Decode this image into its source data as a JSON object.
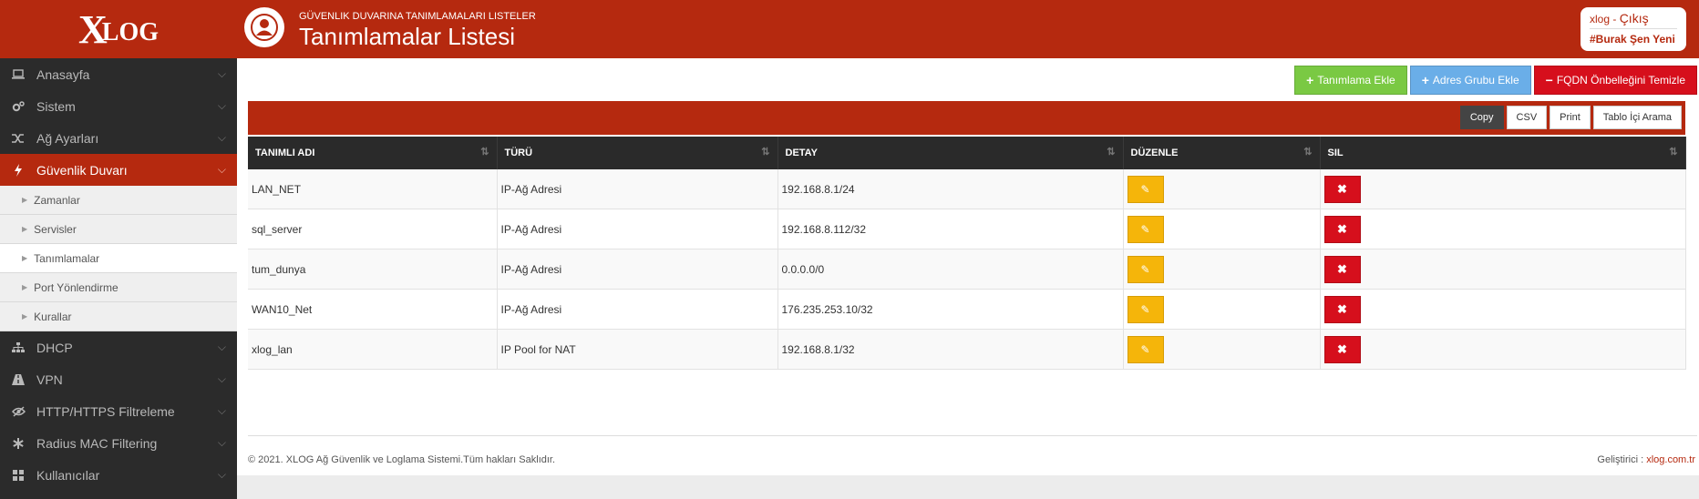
{
  "header": {
    "logo_big": "X",
    "logo_small": "LOG",
    "subtitle": "GÜVENLIK DUVARINA TANIMLAMALARI LISTELER",
    "title": "Tanımlamalar Listesi",
    "user_app": "xlog - ",
    "logout": "Çıkış",
    "user_name": "#Burak Şen Yeni"
  },
  "sidebar": {
    "items_top": [
      {
        "label": "Anasayfa",
        "icon": "laptop-icon"
      },
      {
        "label": "Sistem",
        "icon": "cogs-icon"
      },
      {
        "label": "Ağ Ayarları",
        "icon": "shuffle-icon"
      },
      {
        "label": "Güvenlik Duvarı",
        "icon": "bolt-icon",
        "active": true
      }
    ],
    "subitems": [
      {
        "label": "Zamanlar"
      },
      {
        "label": "Servisler"
      },
      {
        "label": "Tanımlamalar",
        "current": true
      },
      {
        "label": "Port Yönlendirme"
      },
      {
        "label": "Kurallar"
      }
    ],
    "items_bottom": [
      {
        "label": "DHCP",
        "icon": "sitemap-icon"
      },
      {
        "label": "VPN",
        "icon": "road-icon"
      },
      {
        "label": "HTTP/HTTPS Filtreleme",
        "icon": "eye-slash-icon"
      },
      {
        "label": "Radius MAC Filtering",
        "icon": "asterisk-icon"
      },
      {
        "label": "Kullanıcılar",
        "icon": "grid-icon"
      }
    ]
  },
  "actions": {
    "add_definition": "Tanımlama Ekle",
    "add_address_group": "Adres Grubu Ekle",
    "clear_fqdn": "FQDN Önbelleğini Temizle"
  },
  "tools": {
    "copy": "Copy",
    "csv": "CSV",
    "print": "Print",
    "search": "Tablo İçi Arama"
  },
  "table": {
    "columns": [
      "TANIMLI ADI",
      "TÜRÜ",
      "DETAY",
      "DÜZENLE",
      "SIL"
    ],
    "rows": [
      {
        "name": "LAN_NET",
        "type": "IP-Ağ Adresi",
        "detail": "192.168.8.1/24"
      },
      {
        "name": "sql_server",
        "type": "IP-Ağ Adresi",
        "detail": "192.168.8.112/32"
      },
      {
        "name": "tum_dunya",
        "type": "IP-Ağ Adresi",
        "detail": "0.0.0.0/0"
      },
      {
        "name": "WAN10_Net",
        "type": "IP-Ağ Adresi",
        "detail": "176.235.253.10/32"
      },
      {
        "name": "xlog_lan",
        "type": "IP Pool for NAT",
        "detail": "192.168.8.1/32"
      }
    ]
  },
  "footer": {
    "copyright": "© 2021. XLOG Ağ Güvenlik ve Loglama Sistemi.Tüm hakları Saklıdır.",
    "developer_label": "Geliştirici : ",
    "developer_link": "xlog.com.tr"
  },
  "colors": {
    "brand": "#b5290f",
    "add_green": "#7ac943",
    "add_blue": "#6aaee8",
    "danger_red": "#d60f1c",
    "edit_yellow": "#f5b50a"
  }
}
